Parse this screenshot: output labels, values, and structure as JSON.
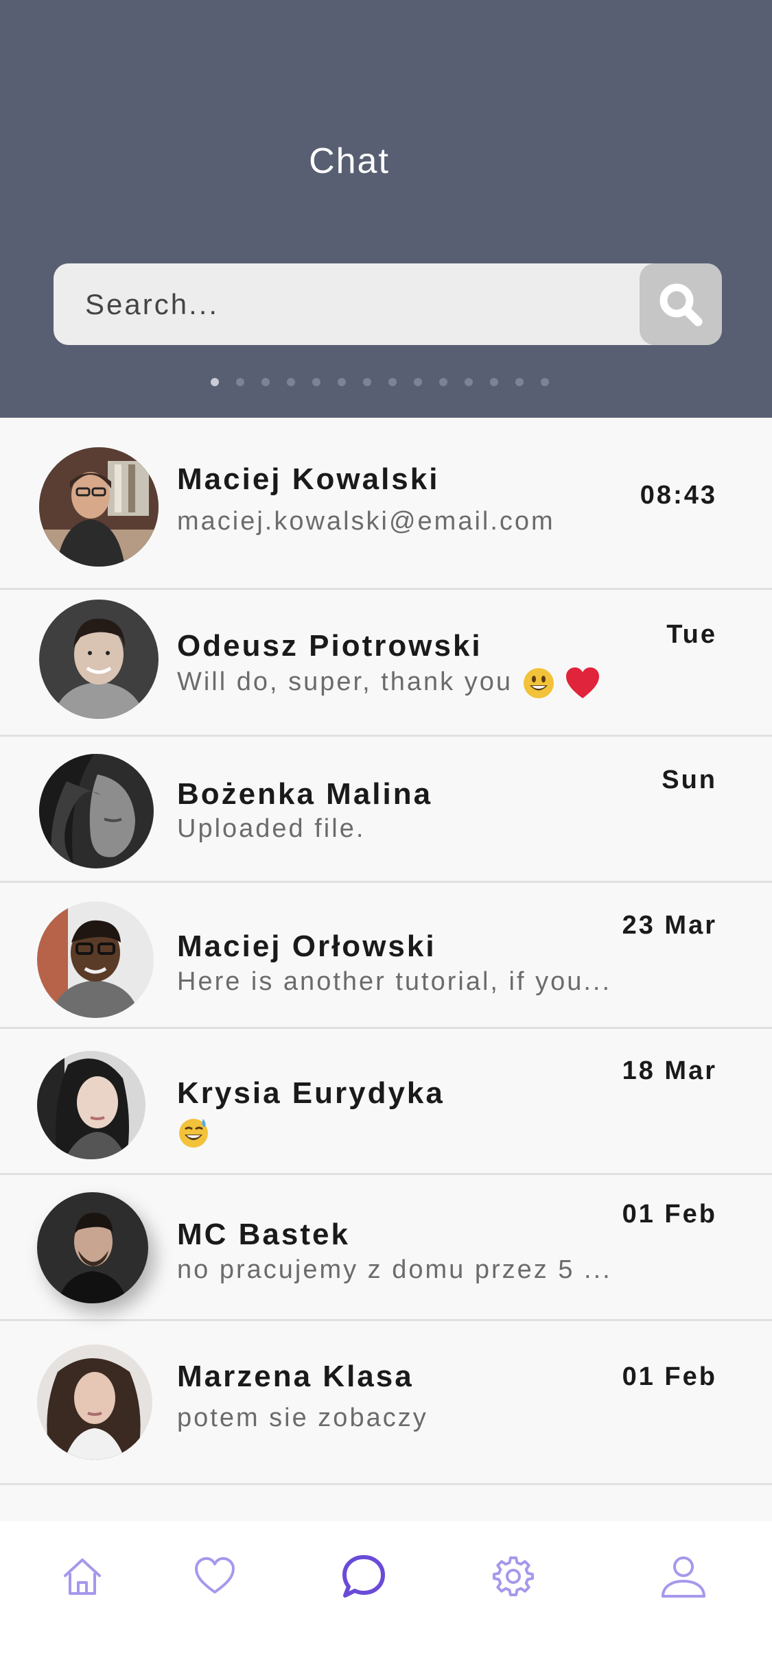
{
  "header": {
    "title": "Chat"
  },
  "search": {
    "placeholder": "Search...",
    "icon": "search-icon"
  },
  "pager": {
    "count": 14,
    "active": 1
  },
  "chats": [
    {
      "name": "Maciej Kowalski",
      "preview": "maciej.kowalski@email.com",
      "time": "08:43"
    },
    {
      "name": "Odeusz Piotrowski",
      "preview": "Will do, super, thank you",
      "time": "Tue",
      "emojis": [
        "grinning-face-emoji",
        "red-heart-emoji"
      ]
    },
    {
      "name": "Bożenka Malina",
      "preview": "Uploaded file.",
      "time": "Sun"
    },
    {
      "name": "Maciej Orłowski",
      "preview": "Here is another tutorial, if you...",
      "time": "23 Mar"
    },
    {
      "name": "Krysia Eurydyka",
      "preview": "",
      "time": "18 Mar",
      "emojis": [
        "grinning-sweat-emoji"
      ]
    },
    {
      "name": "MC Bastek",
      "preview": "no pracujemy z domu przez 5 ...",
      "time": "01 Feb"
    },
    {
      "name": "Marzena Klasa",
      "preview": "potem sie zobaczy",
      "time": "01 Feb"
    }
  ],
  "nav": {
    "items": [
      "home-icon",
      "heart-icon",
      "chat-icon",
      "settings-icon",
      "profile-icon"
    ],
    "active": "chat-icon",
    "colors": {
      "accent": "#6a4bd8",
      "inactive": "#a797ec"
    }
  },
  "colors": {
    "header": "#595f72",
    "background": "#f8f8f8"
  }
}
